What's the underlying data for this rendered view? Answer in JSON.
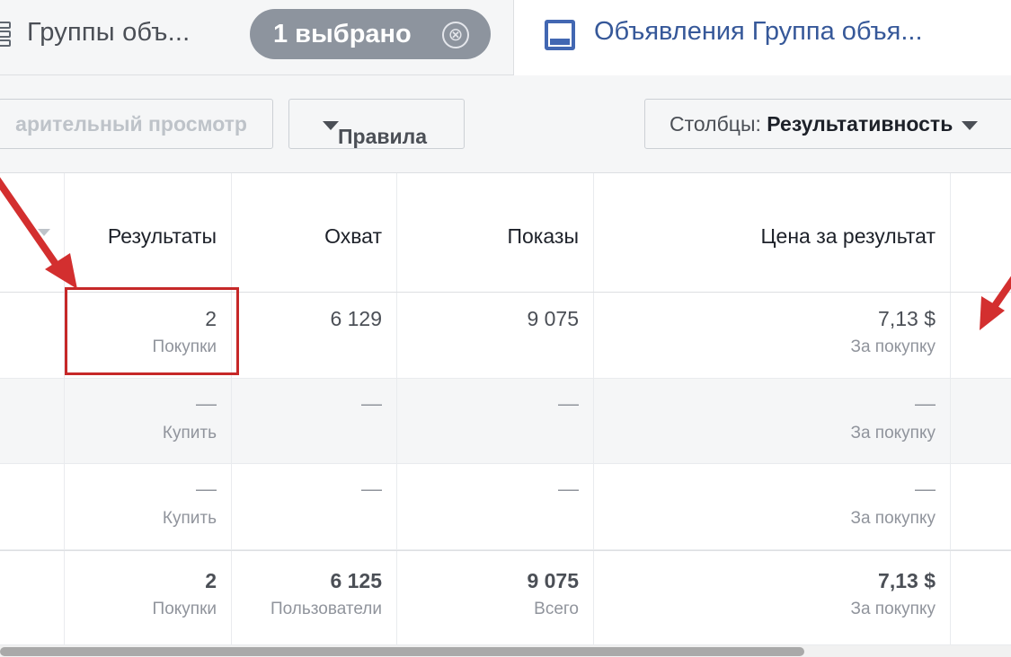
{
  "tabs": {
    "adsets": {
      "label": "Группы объ...",
      "icon": "grid-icon"
    },
    "selection_chip": {
      "label": "1 выбрано",
      "close_glyph": "⊗"
    },
    "ads": {
      "label": "Объявления Группа объя...",
      "icon": "ad-icon"
    }
  },
  "toolbar": {
    "preview_label": "арительный просмотр",
    "rules_label": "Правила",
    "columns_prefix": "Столбцы:",
    "columns_value": "Результативность"
  },
  "table": {
    "headers": [
      "Результаты",
      "Охват",
      "Показы",
      "Цена за результат"
    ],
    "rows": [
      {
        "results": "2",
        "results_sub": "Покупки",
        "reach": "6 129",
        "reach_sub": "",
        "impressions": "9 075",
        "impressions_sub": "",
        "cost": "7,13 $",
        "cost_sub": "За покупку"
      },
      {
        "results": "—",
        "results_sub": "Купить",
        "reach": "—",
        "reach_sub": "",
        "impressions": "—",
        "impressions_sub": "",
        "cost": "—",
        "cost_sub": "За покупку"
      },
      {
        "results": "—",
        "results_sub": "Купить",
        "reach": "—",
        "reach_sub": "",
        "impressions": "—",
        "impressions_sub": "",
        "cost": "—",
        "cost_sub": "За покупку"
      }
    ],
    "totals": {
      "results": "2",
      "results_sub": "Покупки",
      "reach": "6 125",
      "reach_sub": "Пользователи",
      "impressions": "9 075",
      "impressions_sub": "Всего",
      "cost": "7,13 $",
      "cost_sub": "За покупку"
    }
  },
  "colors": {
    "accent": "#4267b2",
    "link": "#365899",
    "highlight": "#c62828",
    "chip": "#8d949e"
  }
}
